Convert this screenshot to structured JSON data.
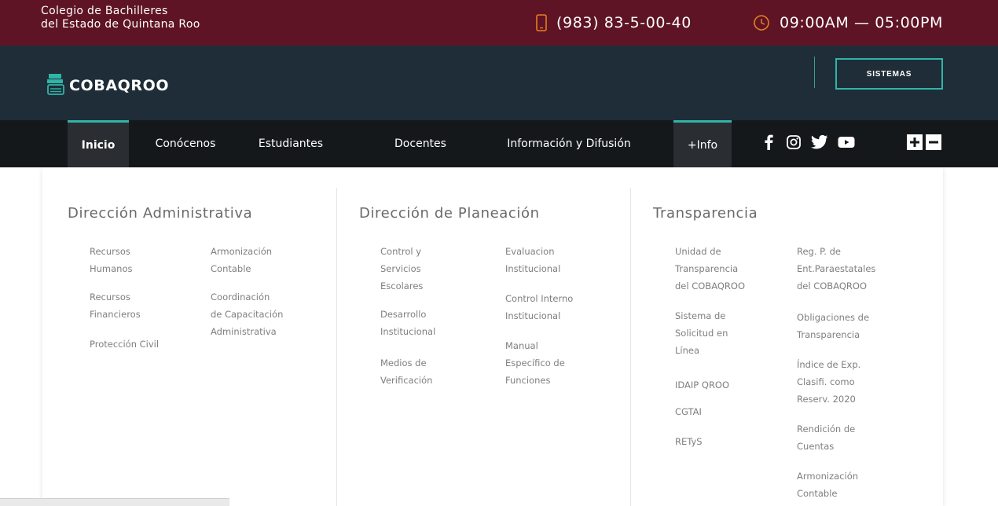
{
  "topbar": {
    "org_line1": "Colegio de Bachilleres",
    "org_line2": "del Estado de Quintana Roo",
    "phone": "(983) 83-5-00-40",
    "hours": "09:00AM — 05:00PM",
    "icons": {
      "phone": "phone-icon",
      "clock": "clock-icon"
    },
    "accent_color": "#e67e22"
  },
  "header": {
    "logo_text": "COBAQROO",
    "sistemas_label": "SISTEMAS",
    "accent_color": "#2fb5a7"
  },
  "nav": {
    "items": [
      {
        "label": "Inicio",
        "active": true
      },
      {
        "label": "Conócenos"
      },
      {
        "label": "Estudiantes"
      },
      {
        "label": "Docentes"
      },
      {
        "label": "Información y Difusión"
      },
      {
        "label": "+Info",
        "open": true
      }
    ],
    "social": [
      "facebook-icon",
      "instagram-icon",
      "twitter-icon",
      "youtube-icon"
    ],
    "zoom": [
      "zoom-in-icon",
      "zoom-out-icon"
    ]
  },
  "megamenu": {
    "sections": [
      {
        "title": "Dirección Administrativa",
        "links": [
          [
            "Recursos",
            "Humanos"
          ],
          [
            "Recursos",
            "Financieros"
          ],
          [
            "Protección Civil"
          ],
          [
            "Armonización",
            "Contable"
          ],
          [
            "Coordinación",
            "de Capacitación",
            "Administrativa"
          ]
        ]
      },
      {
        "title": "Dirección de Planeación",
        "links": [
          [
            "Control y",
            "Servicios",
            "Escolares"
          ],
          [
            "Desarrollo",
            "Institucional"
          ],
          [
            "Medios de",
            "Verificación"
          ],
          [
            "Evaluacion",
            "Institucional"
          ],
          [
            "Control Interno",
            "Institucional"
          ],
          [
            "Manual",
            "Específico de",
            "Funciones"
          ]
        ]
      },
      {
        "title": "Transparencia",
        "links": [
          [
            "Unidad de",
            "Transparencia",
            "del COBAQROO"
          ],
          [
            "Sistema de",
            "Solicitud en",
            "Línea"
          ],
          [
            "IDAIP QROO"
          ],
          [
            "CGTAI"
          ],
          [
            "RETyS"
          ],
          [
            "Reg. P. de",
            "Ent.Paraestatales",
            "del COBAQROO"
          ],
          [
            "Obligaciones de",
            "Transparencia"
          ],
          [
            "Índice de Exp.",
            "Clasifi. como",
            "Reserv. 2020"
          ],
          [
            "Rendición de",
            "Cuentas"
          ],
          [
            "Armonización",
            "Contable"
          ]
        ]
      }
    ]
  }
}
